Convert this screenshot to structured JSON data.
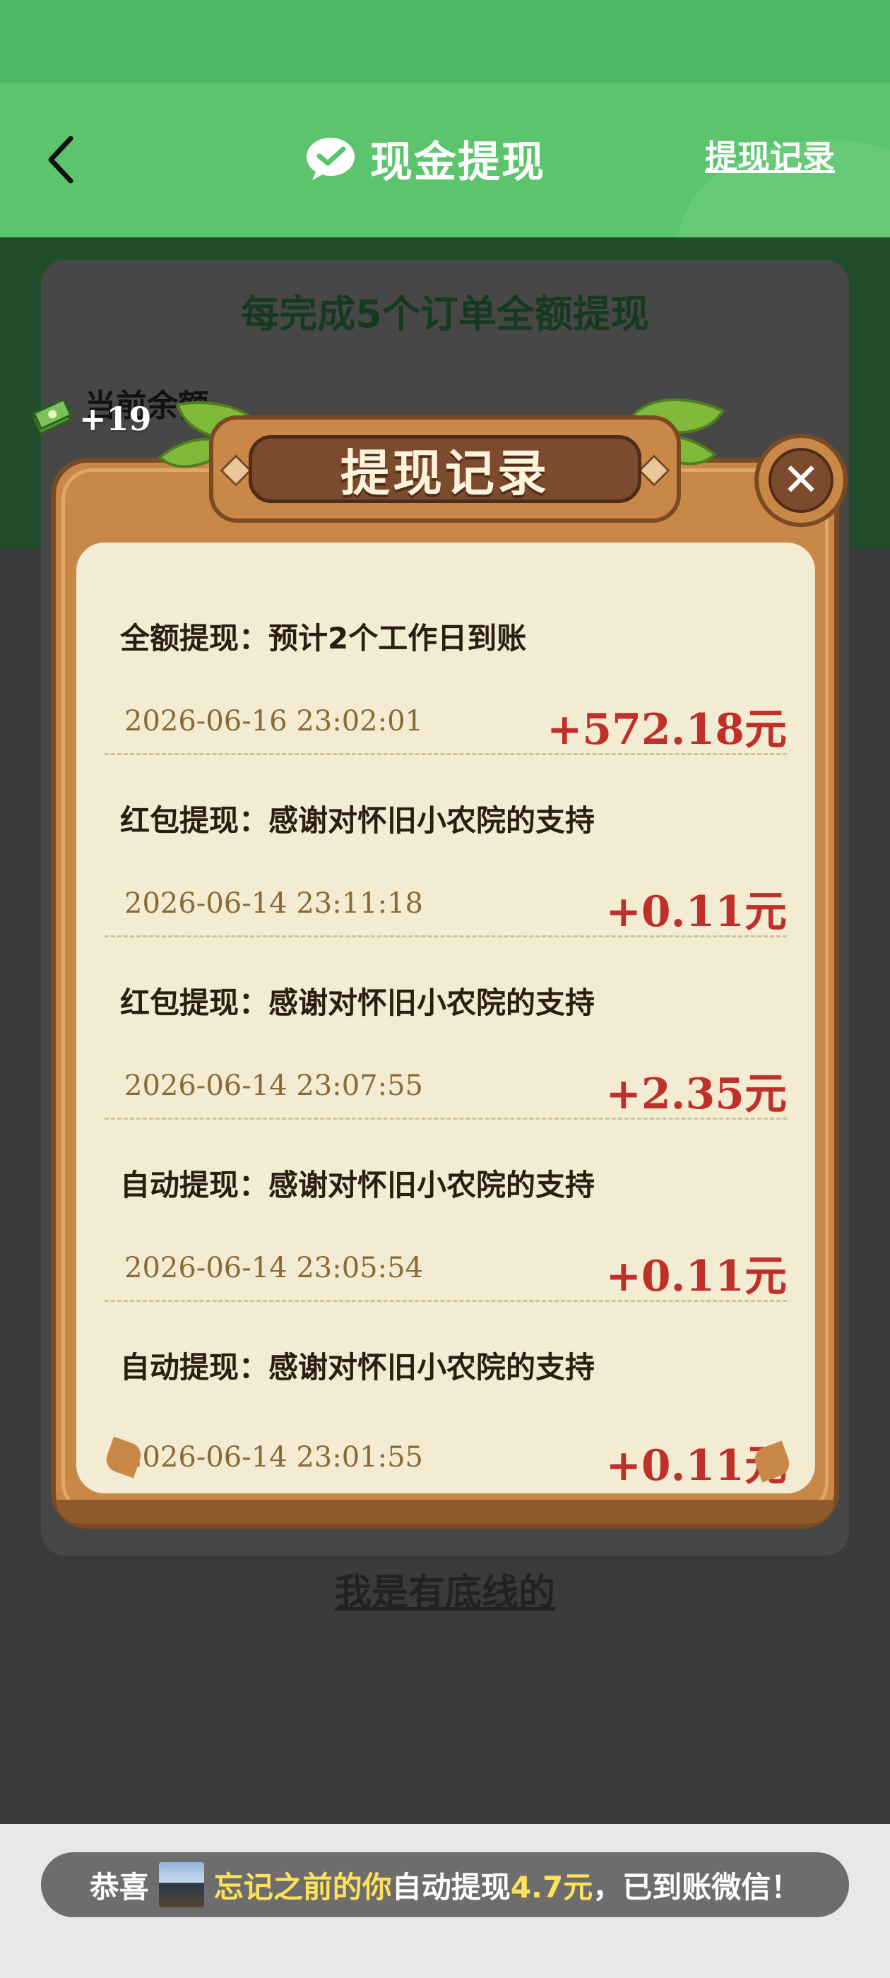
{
  "header": {
    "title": "现金提现",
    "record_link": "提现记录",
    "icons": {
      "back": "chevron-left-icon",
      "wechat": "wechat-icon"
    }
  },
  "background": {
    "subtitle": "每完成5个订单全额提现",
    "balance_label": "当前余额",
    "bottom_link": "我是有底线的",
    "float_reward": "+19"
  },
  "modal": {
    "title": "提现记录",
    "close_icon": "close-icon",
    "records": [
      {
        "title": "全额提现：预计2个工作日到账",
        "time": "2026-06-16  23:02:01",
        "amount": "+572.18元"
      },
      {
        "title": "红包提现：感谢对怀旧小农院的支持",
        "time": "2026-06-14  23:11:18",
        "amount": "+0.11元"
      },
      {
        "title": "红包提现：感谢对怀旧小农院的支持",
        "time": "2026-06-14  23:07:55",
        "amount": "+2.35元"
      },
      {
        "title": "自动提现：感谢对怀旧小农院的支持",
        "time": "2026-06-14  23:05:54",
        "amount": "+0.11元"
      },
      {
        "title": "自动提现：感谢对怀旧小农院的支持",
        "time": "2026-06-14  23:01:55",
        "amount": "+0.11元"
      }
    ]
  },
  "toast": {
    "prefix": "恭喜",
    "user": "忘记之前的你",
    "action": "自动提现",
    "amount": "4.7元",
    "suffix": "，已到账微信！"
  },
  "colors": {
    "header_green": "#5dc46e",
    "wood": "#c98848",
    "wood_dark": "#7a4a22",
    "paper": "#f3ecd2",
    "amount_red": "#c0302a",
    "highlight_yellow": "#ffe15a"
  }
}
